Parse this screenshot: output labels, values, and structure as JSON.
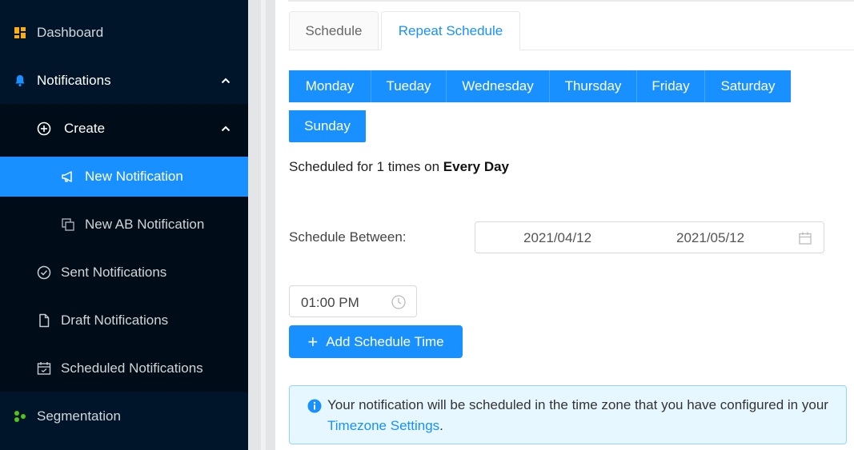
{
  "sidebar": {
    "dashboard": "Dashboard",
    "notifications": "Notifications",
    "create": "Create",
    "new_notification": "New Notification",
    "new_ab_notification": "New AB Notification",
    "sent_notifications": "Sent Notifications",
    "draft_notifications": "Draft Notifications",
    "scheduled_notifications": "Scheduled Notifications",
    "segmentation": "Segmentation"
  },
  "tabs": {
    "schedule": "Schedule",
    "repeat_schedule": "Repeat Schedule"
  },
  "days": [
    "Monday",
    "Tueday",
    "Wednesday",
    "Thursday",
    "Friday",
    "Saturday",
    "Sunday"
  ],
  "summary": {
    "prefix": "Scheduled for 1 times on ",
    "bold": "Every Day"
  },
  "schedule_between": {
    "label": "Schedule Between:",
    "start": "2021/04/12",
    "end": "2021/05/12"
  },
  "time": "01:00 PM",
  "add_button": "Add Schedule Time",
  "alert": {
    "text": "Your notification will be scheduled in the time zone that you have configured in your ",
    "link": "Timezone Settings",
    "suffix": "."
  },
  "colors": {
    "sidebar_bg": "#001529",
    "submenu_bg": "#000c17",
    "primary": "#1890ff",
    "alert_bg": "#e6f7ff"
  },
  "icons": {
    "dashboard": "dashboard-icon",
    "notifications": "bell-icon",
    "create": "plus-circle-icon",
    "new_notification": "megaphone-icon",
    "new_ab_notification": "copy-icon",
    "sent": "check-circle-icon",
    "draft": "file-icon",
    "scheduled": "calendar-icon",
    "segmentation": "cluster-icon"
  }
}
